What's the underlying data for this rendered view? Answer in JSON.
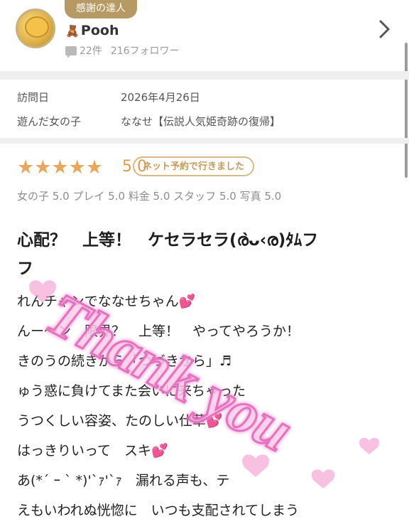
{
  "profile": {
    "badge": "感謝の達人",
    "avatar_emoji": "🧸",
    "name": "Pooh",
    "reviews": "22件",
    "followers": "216フォロワー"
  },
  "visit": {
    "date_label": "訪問日",
    "date_value": "2026年4月26日",
    "girl_label": "遊んだ女の子",
    "girl_value": "ななせ【伝説人気姫奇跡の復帰】"
  },
  "rating": {
    "stars": "★★★★★",
    "score": "5.0",
    "booking_pill": "ネット予約で行きました",
    "subscores": "女の子 5.0  プレイ 5.0  料金 5.0  スタッフ 5.0  写真 5.0"
  },
  "review": {
    "title_line1": "心配？　上等！　ケセラセラ(ര̀ᴗ‹ര)ﾀﾑフ",
    "title_line2": "フ",
    "lines": [
      "れんチャンでななせちゃん",
      "んー〜ン　限界？　上等！　やってやろうか！",
      "きのうの続きから「つづきから」♬",
      "ゅう惑に負けてまた会いに来ちゃった",
      "うつくしい容姿、たのしい仕草",
      "はっきりいって　スキ",
      "あ(*´ ｰ ` *)'`ｧ'`ｧ　漏れる声も、テ",
      "えもいわれぬ恍惚に　いつも支配されてしまう"
    ]
  },
  "overlay": {
    "text": "Thank you"
  },
  "colors": {
    "star": "#e8a75a",
    "accent": "#b79a63",
    "heart": "#ea4fb0"
  }
}
